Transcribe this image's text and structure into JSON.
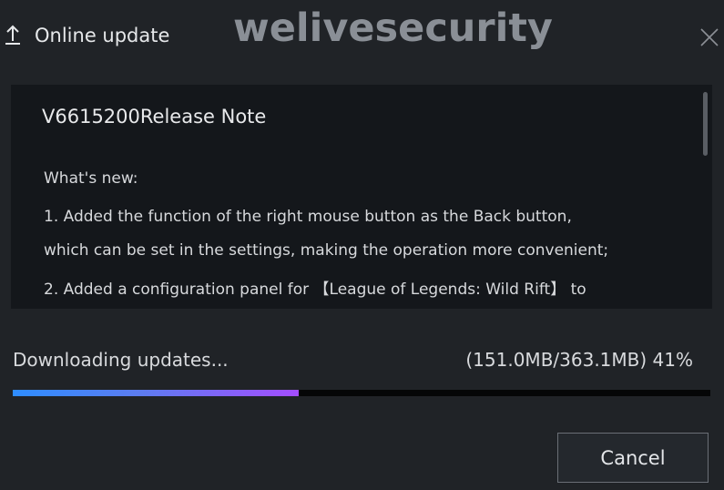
{
  "window": {
    "title": "Online update",
    "close_icon": "close-icon",
    "title_icon": "upload-icon"
  },
  "watermark": "welivesecurity",
  "release_notes": {
    "title": "V6615200Release Note",
    "lines": [
      "What's new:",
      "1. Added the function of the right mouse button as the Back button,",
      "which can be set in the settings, making the operation more convenient;",
      "2. Added a configuration panel for 【League of Legends: Wild Rift】 to"
    ]
  },
  "download": {
    "status": "Downloading updates...",
    "progress_label": "(151.0MB/363.1MB)  41%",
    "downloaded": "151.0MB",
    "total": "363.1MB",
    "percent": 41
  },
  "buttons": {
    "cancel": "Cancel"
  },
  "colors": {
    "background": "#202327",
    "panel": "#14171b",
    "progress_start": "#2e8dff",
    "progress_end": "#a44dff"
  }
}
